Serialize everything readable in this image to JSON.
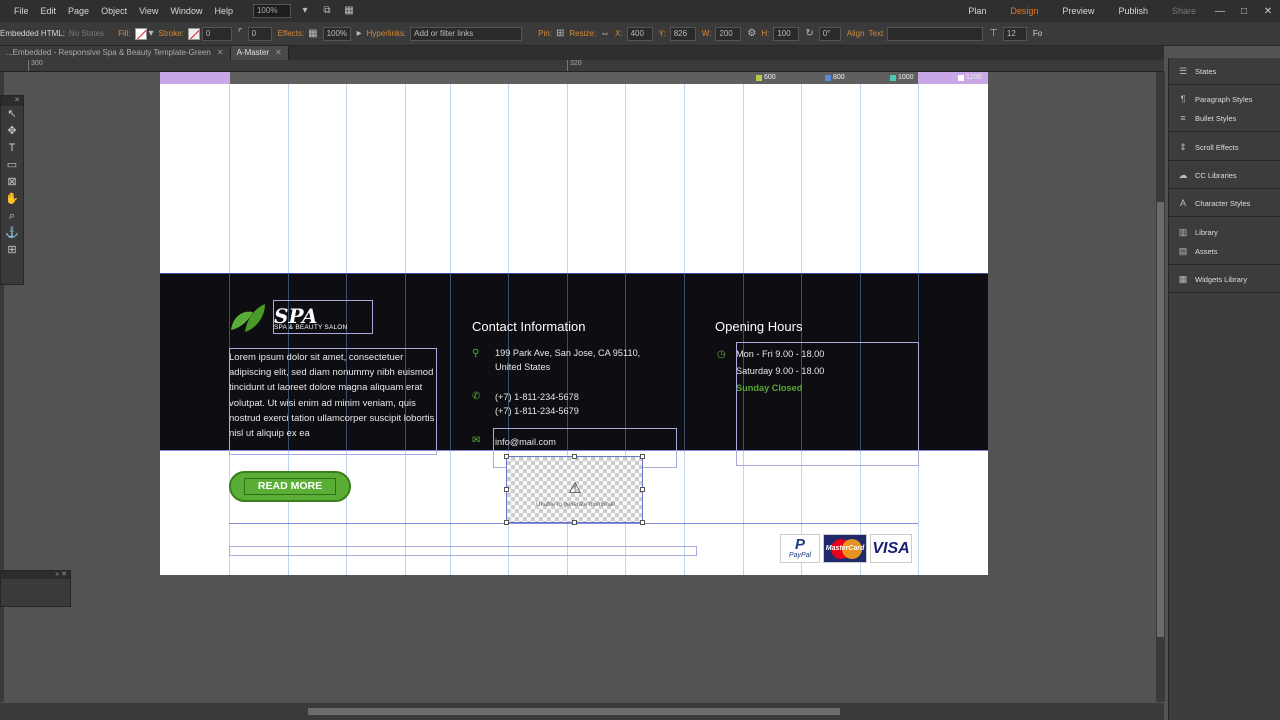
{
  "menubar": {
    "items": [
      "File",
      "Edit",
      "Page",
      "Object",
      "View",
      "Window",
      "Help"
    ],
    "zoom": "100%",
    "modes": [
      "Plan",
      "Design",
      "Preview",
      "Publish",
      "Share"
    ],
    "window_controls": [
      "—",
      "□",
      "✕"
    ]
  },
  "controlbar": {
    "embedded_html_label": "Embedded HTML:",
    "states_value": "No States",
    "fill_label": "Fill:",
    "stroke_label": "Stroke:",
    "stroke_value": "0",
    "stroke_extra": "0",
    "effects_label": "Effects:",
    "effects_value": "100%",
    "hyperlinks_label": "Hyperlinks:",
    "hyperlinks_value": "Add or filter links",
    "pin_label": "Pin:",
    "resize_label": "Resize:",
    "x_label": "X:",
    "x_value": "400",
    "y_label": "Y:",
    "y_value": "826",
    "w_label": "W:",
    "w_value": "200",
    "h_label": "H:",
    "h_value": "100",
    "rotation_value": "0°",
    "align_label": "Align",
    "text_label": "Text",
    "font_size": "12",
    "trailing_label": "Fo"
  },
  "doctabs": [
    {
      "label": "...Embedded - Responsive Spa & Beauty Template-Green",
      "active": false
    },
    {
      "label": "A-Master",
      "active": true
    }
  ],
  "ruler": {
    "ticks": [
      "300",
      "320"
    ],
    "breakpoints": [
      "600",
      "800",
      "1000",
      "1200"
    ],
    "breakpoint_colors": [
      "#b8c94a",
      "#5a8ad8",
      "#4ec7b0",
      "#ffffff"
    ]
  },
  "tools": [
    "↖",
    "✥",
    "T",
    "▭",
    "⊠",
    "✋",
    "⌕",
    "⚓",
    "⊞"
  ],
  "footer": {
    "logo_text": "SPA",
    "logo_sub": "SPA & BEAUTY SALON",
    "lorem": "Lorem ipsum dolor sit amet, consectetuer adipiscing elit, sed diam nonummy nibh euismod tincidunt ut laoreet dolore magna aliquam erat volutpat. Ut wisi enim ad minim veniam, quis nostrud exerci tation ullamcorper suscipit lobortis nisl ut aliquip ex ea",
    "read_more": "READ MORE",
    "contact_title": "Contact Information",
    "address": "199 Park Ave, San Jose, CA 95110, United States",
    "phone1": "(+7) 1-811-234-5678",
    "phone2": "(+7) 1-811-234-5679",
    "email": "info@mail.com",
    "hours_title": "Opening Hours",
    "hours1": "Mon - Fri 9.00 - 18.00",
    "hours2": "Saturday 9.00 - 18.00",
    "hours3": "Sunday Closed",
    "thumb_warning": "Unable to generate thumbnail",
    "payments": [
      "PayPal",
      "MasterCard",
      "VISA"
    ],
    "paypal_mark": "P"
  },
  "right_panel": {
    "items": [
      "States",
      "Paragraph Styles",
      "Bullet Styles",
      "Scroll Effects",
      "CC Libraries",
      "Character Styles",
      "Library",
      "Assets",
      "Widgets Library"
    ],
    "icons": [
      "☰",
      "¶",
      "≡",
      "⇕",
      "☁",
      "A",
      "▥",
      "▤",
      "▦"
    ]
  },
  "colors": {
    "accent_orange": "#e87722",
    "spa_green": "#5aae35",
    "footer_bg": "#0e0e12",
    "guide_blue": "#6a74c8"
  }
}
